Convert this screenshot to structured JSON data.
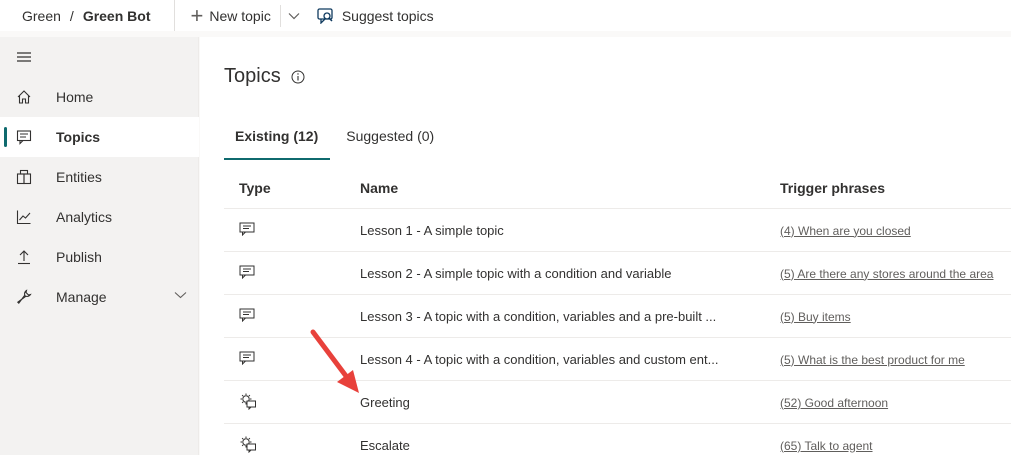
{
  "breadcrumb": {
    "env": "Green",
    "separator": "/",
    "bot": "Green Bot"
  },
  "toolbar": {
    "new_topic": "New topic",
    "suggest_topics": "Suggest topics"
  },
  "nav": {
    "items": [
      {
        "label": "Home",
        "icon": "home-icon"
      },
      {
        "label": "Topics",
        "icon": "chat-icon",
        "active": true
      },
      {
        "label": "Entities",
        "icon": "entities-icon"
      },
      {
        "label": "Analytics",
        "icon": "analytics-icon"
      },
      {
        "label": "Publish",
        "icon": "publish-icon"
      },
      {
        "label": "Manage",
        "icon": "wrench-icon",
        "expandable": true
      }
    ]
  },
  "page": {
    "title": "Topics"
  },
  "tabs": [
    {
      "label": "Existing (12)",
      "active": true
    },
    {
      "label": "Suggested (0)"
    }
  ],
  "table": {
    "columns": {
      "type": "Type",
      "name": "Name",
      "trigger": "Trigger phrases"
    },
    "rows": [
      {
        "type": "user-topic-icon",
        "name": "Lesson 1 - A simple topic",
        "trigger": "(4) When are you closed"
      },
      {
        "type": "user-topic-icon",
        "name": "Lesson 2 - A simple topic with a condition and variable",
        "trigger": "(5) Are there any stores around the area"
      },
      {
        "type": "user-topic-icon",
        "name": "Lesson 3 - A topic with a condition, variables and a pre-built ...",
        "trigger": "(5) Buy items"
      },
      {
        "type": "user-topic-icon",
        "name": "Lesson 4 - A topic with a condition, variables and custom ent...",
        "trigger": "(5) What is the best product for me"
      },
      {
        "type": "system-topic-icon",
        "name": "Greeting",
        "trigger": "(52) Good afternoon"
      },
      {
        "type": "system-topic-icon",
        "name": "Escalate",
        "trigger": "(65) Talk to agent"
      }
    ]
  },
  "colors": {
    "accent": "#0f6a6e",
    "annotation_arrow": "#e8413b"
  }
}
